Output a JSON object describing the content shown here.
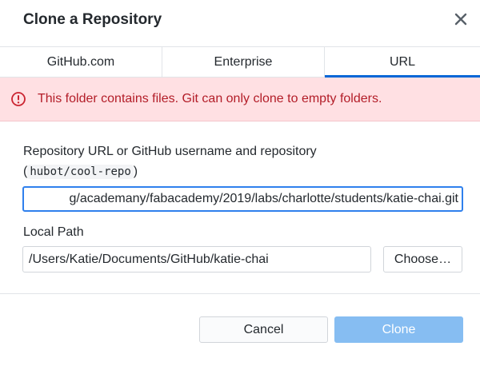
{
  "dialog": {
    "title": "Clone a Repository"
  },
  "icons": {
    "close": "close-icon",
    "error": "alert-circle-icon"
  },
  "tabs": [
    {
      "label": "GitHub.com",
      "selected": false
    },
    {
      "label": "Enterprise",
      "selected": false
    },
    {
      "label": "URL",
      "selected": true
    }
  ],
  "error": {
    "message": "This folder contains files. Git can only clone to empty folders."
  },
  "url_field": {
    "label": "Repository URL or GitHub username and repository",
    "hint_open": "(",
    "hint_code": "hubot/cool-repo",
    "hint_close": ")",
    "value": "g/academany/fabacademy/2019/labs/charlotte/students/katie-chai.git"
  },
  "path_field": {
    "label": "Local Path",
    "value": "/Users/Katie/Documents/GitHub/katie-chai"
  },
  "buttons": {
    "choose": "Choose…",
    "cancel": "Cancel",
    "clone": "Clone"
  },
  "colors": {
    "accent": "#0366d6",
    "error_bg": "#ffe0e3",
    "error_text": "#b31d28",
    "clone_disabled": "#86bdf2"
  }
}
